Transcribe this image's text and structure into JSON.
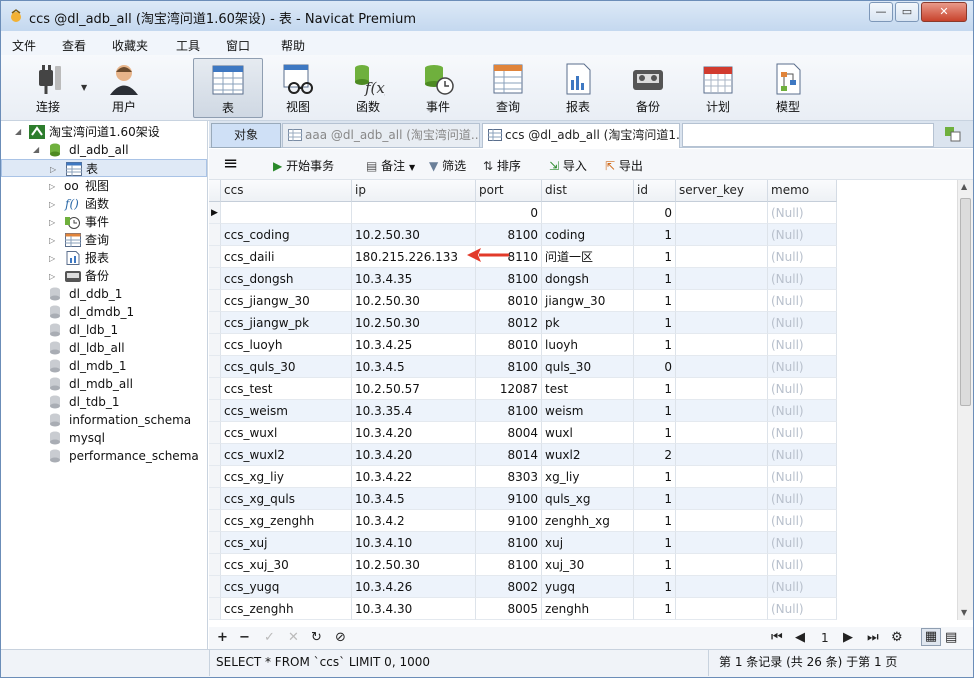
{
  "window": {
    "title": "ccs @dl_adb_all (淘宝湾问道1.60架设) - 表 - Navicat Premium",
    "minimize": "—",
    "restore": "▭",
    "close": "✕"
  },
  "menu": [
    "文件",
    "查看",
    "收藏夹",
    "工具",
    "窗口",
    "帮助"
  ],
  "toolbar": {
    "connect": "连接",
    "user": "用户",
    "table": "表",
    "view": "视图",
    "function": "函数",
    "event": "事件",
    "query": "查询",
    "report": "报表",
    "backup": "备份",
    "schedule": "计划",
    "model": "模型"
  },
  "nav": {
    "connection": "淘宝湾问道1.60架设",
    "database": "dl_adb_all",
    "objects": [
      "表",
      "视图",
      "函数",
      "事件",
      "查询",
      "报表",
      "备份"
    ],
    "other_dbs": [
      "dl_ddb_1",
      "dl_dmdb_1",
      "dl_ldb_1",
      "dl_ldb_all",
      "dl_mdb_1",
      "dl_mdb_all",
      "dl_tdb_1",
      "information_schema",
      "mysql",
      "performance_schema"
    ]
  },
  "tabs": {
    "objects": "对象",
    "tab1": "aaa @dl_adb_all (淘宝湾问道...",
    "tab2": "ccs @dl_adb_all (淘宝湾问道1..."
  },
  "subtoolbar": {
    "menu_icon": "≡",
    "begin_tx": "开始事务",
    "memo": "备注",
    "filter": "筛选",
    "sort": "排序",
    "import": "导入",
    "export": "导出"
  },
  "grid": {
    "columns": [
      "ccs",
      "ip",
      "port",
      "dist",
      "id",
      "server_key",
      "memo"
    ],
    "null_text": "(Null)",
    "rows": [
      [
        "",
        "",
        "0",
        "",
        "0",
        "",
        "(Null)"
      ],
      [
        "ccs_coding",
        "10.2.50.30",
        "8100",
        "coding",
        "1",
        "",
        "(Null)"
      ],
      [
        "ccs_daili",
        "180.215.226.133",
        "8110",
        "问道一区",
        "1",
        "",
        "(Null)"
      ],
      [
        "ccs_dongsh",
        "10.3.4.35",
        "8100",
        "dongsh",
        "1",
        "",
        "(Null)"
      ],
      [
        "ccs_jiangw_30",
        "10.2.50.30",
        "8010",
        "jiangw_30",
        "1",
        "",
        "(Null)"
      ],
      [
        "ccs_jiangw_pk",
        "10.2.50.30",
        "8012",
        "pk",
        "1",
        "",
        "(Null)"
      ],
      [
        "ccs_luoyh",
        "10.3.4.25",
        "8010",
        "luoyh",
        "1",
        "",
        "(Null)"
      ],
      [
        "ccs_quls_30",
        "10.3.4.5",
        "8100",
        "quls_30",
        "0",
        "",
        "(Null)"
      ],
      [
        "ccs_test",
        "10.2.50.57",
        "12087",
        "test",
        "1",
        "",
        "(Null)"
      ],
      [
        "ccs_weism",
        "10.3.35.4",
        "8100",
        "weism",
        "1",
        "",
        "(Null)"
      ],
      [
        "ccs_wuxl",
        "10.3.4.20",
        "8004",
        "wuxl",
        "1",
        "",
        "(Null)"
      ],
      [
        "ccs_wuxl2",
        "10.3.4.20",
        "8014",
        "wuxl2",
        "2",
        "",
        "(Null)"
      ],
      [
        "ccs_xg_liy",
        "10.3.4.22",
        "8303",
        "xg_liy",
        "1",
        "",
        "(Null)"
      ],
      [
        "ccs_xg_quls",
        "10.3.4.5",
        "9100",
        "quls_xg",
        "1",
        "",
        "(Null)"
      ],
      [
        "ccs_xg_zenghh",
        "10.3.4.2",
        "9100",
        "zenghh_xg",
        "1",
        "",
        "(Null)"
      ],
      [
        "ccs_xuj",
        "10.3.4.10",
        "8100",
        "xuj",
        "1",
        "",
        "(Null)"
      ],
      [
        "ccs_xuj_30",
        "10.2.50.30",
        "8100",
        "xuj_30",
        "1",
        "",
        "(Null)"
      ],
      [
        "ccs_yugq",
        "10.3.4.26",
        "8002",
        "yugq",
        "1",
        "",
        "(Null)"
      ],
      [
        "ccs_zenghh",
        "10.3.4.30",
        "8005",
        "zenghh",
        "1",
        "",
        "(Null)"
      ]
    ]
  },
  "pager": {
    "page": "1"
  },
  "status": {
    "sql": "SELECT * FROM `ccs` LIMIT 0, 1000",
    "records": "第 1 条记录 (共 26 条) 于第 1 页"
  },
  "colors": {
    "accent": "#1e6fd0",
    "arrow": "#e23a2a",
    "row_alt": "#edf3fb",
    "null_text": "#b8c0cc"
  }
}
